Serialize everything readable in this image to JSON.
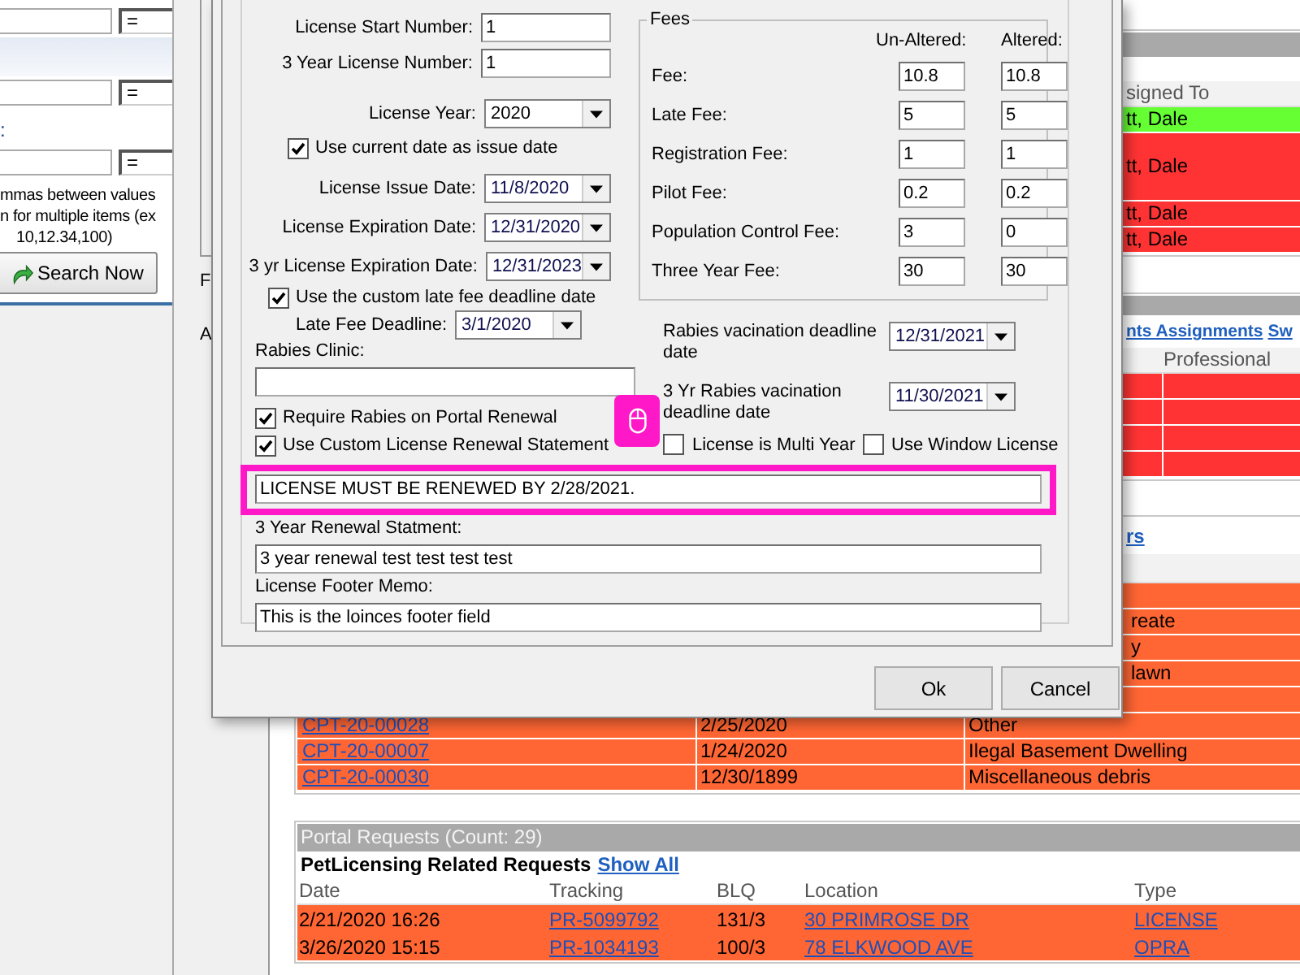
{
  "search_panel": {
    "filters": [
      {
        "operator": "="
      },
      {
        "operator": "="
      },
      {
        "label": ":",
        "operator": "="
      }
    ],
    "hint": [
      "mmas between values",
      "n for multiple items (ex",
      "10,12.34,100)"
    ],
    "search_button": "Search Now"
  },
  "back_window": {
    "labels": [
      "F",
      "A"
    ]
  },
  "page": {
    "assignments": {
      "column": "signed To",
      "rows": [
        {
          "assigned_to": "tt, Dale",
          "color": "#66ff33"
        },
        {
          "assigned_to": "tt, Dale",
          "color": "#ff3333"
        },
        {
          "assigned_to": "tt, Dale",
          "color": "#ff3333"
        },
        {
          "assigned_to": "tt, Dale",
          "color": "#ff3333"
        }
      ]
    },
    "inspections": {
      "links": [
        "nts Assignments",
        "Sw"
      ],
      "column": "Professional",
      "rows": [
        {
          "color": "#ff3333"
        },
        {
          "color": "#ff3333"
        },
        {
          "color": "#ff3333"
        },
        {
          "color": "#ff3333"
        }
      ]
    },
    "complaints": {
      "link": "rs",
      "rows": [
        {
          "color": "#ff6633"
        },
        {
          "column_3": "reate",
          "color": "#ff6633"
        },
        {
          "column_3": "y",
          "color": "#ff6633"
        },
        {
          "column_3": "lawn",
          "color": "#ff6633"
        },
        {
          "color": "#ff6633"
        },
        {
          "column_1": "CPT-20-00028",
          "column_2": "2/25/2020",
          "column_3": "Other",
          "color": "#ff6633"
        },
        {
          "column_1": "CPT-20-00007",
          "column_2": "1/24/2020",
          "column_3": "Ilegal Basement Dwelling",
          "color": "#ff6633"
        },
        {
          "column_1": "CPT-20-00030",
          "column_2": "12/30/1899",
          "column_3": "Miscellaneous debris",
          "color": "#ff6633"
        }
      ]
    },
    "portal_requests": {
      "title": "Portal Requests (Count: 29)",
      "heading": "PetLicensing Related Requests",
      "show_all": "Show All",
      "columns": [
        "Date",
        "Tracking",
        "BLQ",
        "Location",
        "Type"
      ],
      "rows": [
        {
          "date": "2/21/2020 16:26",
          "tracking": "PR-5099792",
          "blq": "131/3",
          "location": "30 PRIMROSE DR",
          "type": "LICENSE",
          "color": "#ff6633"
        },
        {
          "date": "3/26/2020 15:15",
          "tracking": "PR-1034193",
          "blq": "100/3",
          "location": "78 ELKWOOD AVE",
          "type": "OPRA",
          "color": "#ff6633"
        }
      ]
    }
  },
  "dialog": {
    "left_items": [
      {
        "kind": "number",
        "label": "License Start Number:",
        "value": "1"
      },
      {
        "kind": "number",
        "label": "3 Year License Number:",
        "value": "1"
      },
      {
        "kind": "select",
        "label": "License Year:",
        "value": "2020"
      },
      {
        "kind": "checkbox",
        "label": "Use current date as issue date",
        "checked": true
      },
      {
        "kind": "date",
        "label": "License Issue Date:",
        "value": "11/8/2020"
      },
      {
        "kind": "date",
        "label": "License Expiration Date:",
        "value": "12/31/2020"
      },
      {
        "kind": "date",
        "label": "3 yr License Expiration Date:",
        "value": "12/31/2023"
      },
      {
        "kind": "checkbox",
        "label": "Use the custom late fee deadline date",
        "checked": true
      },
      {
        "kind": "date",
        "label": "Late Fee Deadline:",
        "value": "3/1/2020"
      },
      {
        "kind": "text",
        "label": "Rabies Clinic:"
      },
      {
        "kind": "checkbox",
        "label": "Require Rabies on Portal Renewal",
        "checked": true
      },
      {
        "kind": "checkbox",
        "label": "Use Custom License Renewal Statement",
        "checked": true
      }
    ],
    "fees": {
      "title": "Fees",
      "columns": [
        "Un-Altered:",
        "Altered:"
      ],
      "rows": [
        {
          "label": "Fee:",
          "unaltered": "10.8",
          "altered": "10.8"
        },
        {
          "label": "Late Fee:",
          "unaltered": "5",
          "altered": "5"
        },
        {
          "label": "Registration Fee:",
          "unaltered": "1",
          "altered": "1"
        },
        {
          "label": "Pilot Fee:",
          "unaltered": "0.2",
          "altered": "0.2"
        },
        {
          "label": "Population Control Fee:",
          "unaltered": "3",
          "altered": "0"
        },
        {
          "label": "Three Year Fee:",
          "unaltered": "30",
          "altered": "30"
        }
      ]
    },
    "rabies_deadlines": [
      {
        "label": "Rabies vacination deadline date",
        "value": "12/31/2021"
      },
      {
        "label": "3 Yr Rabies vacination deadline date",
        "value": "11/30/2021"
      }
    ],
    "options": [
      {
        "label": "License is Multi Year",
        "checked": false
      },
      {
        "label": "Use Window License",
        "checked": false
      }
    ],
    "statements": [
      {
        "value": "LICENSE MUST BE RENEWED BY 2/28/2021.",
        "highlighted": true
      },
      {
        "label": "3 Year Renewal Statment:",
        "value": "3 year renewal test test test test",
        "highlighted": false
      },
      {
        "label": "License Footer Memo:",
        "value": "This is the loinces footer field",
        "highlighted": false
      }
    ],
    "buttons": [
      "Ok",
      "Cancel"
    ]
  }
}
